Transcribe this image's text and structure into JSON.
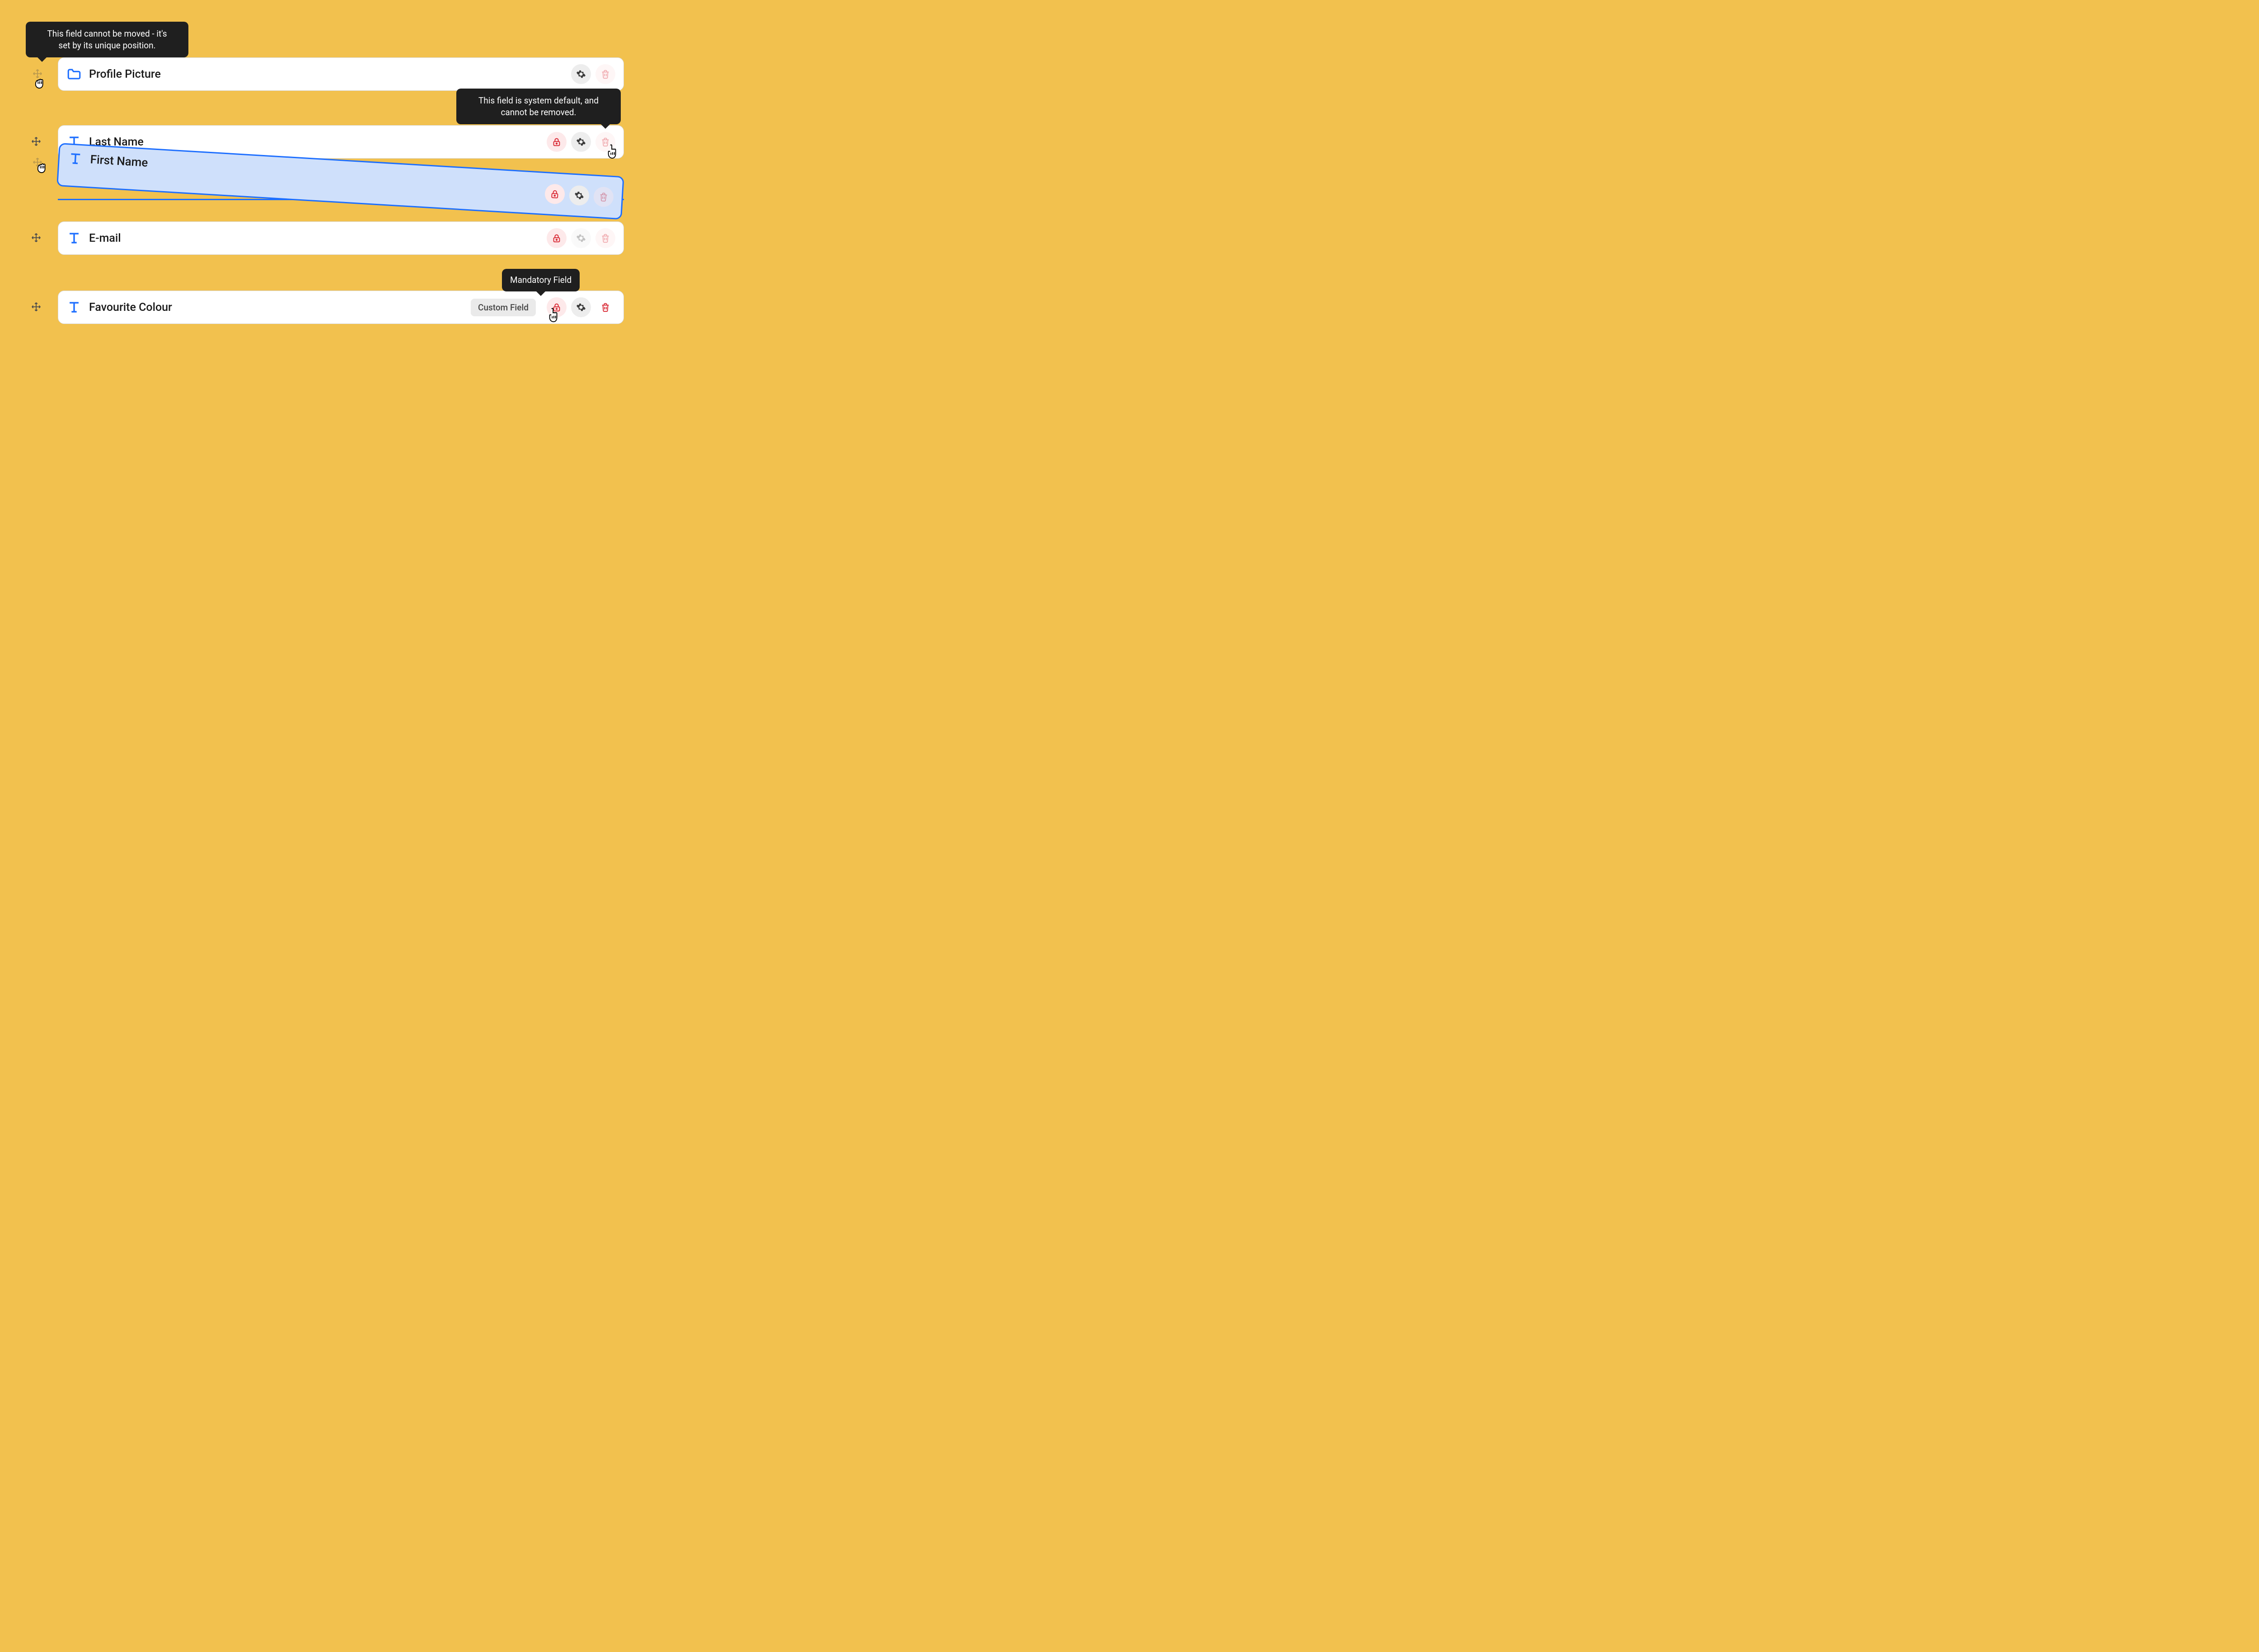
{
  "tooltips": {
    "locked_move": "This field cannot be moved - it's\nset by its unique position.",
    "system_default": "This field is system default, and\ncannot be removed.",
    "mandatory": "Mandatory Field"
  },
  "badges": {
    "custom_field": "Custom Field"
  },
  "fields": {
    "profile_picture": {
      "label": "Profile Picture"
    },
    "last_name": {
      "label": "Last Name"
    },
    "first_name": {
      "label": "First Name"
    },
    "email": {
      "label": "E-mail"
    },
    "favourite_colour": {
      "label": "Favourite Colour"
    }
  }
}
